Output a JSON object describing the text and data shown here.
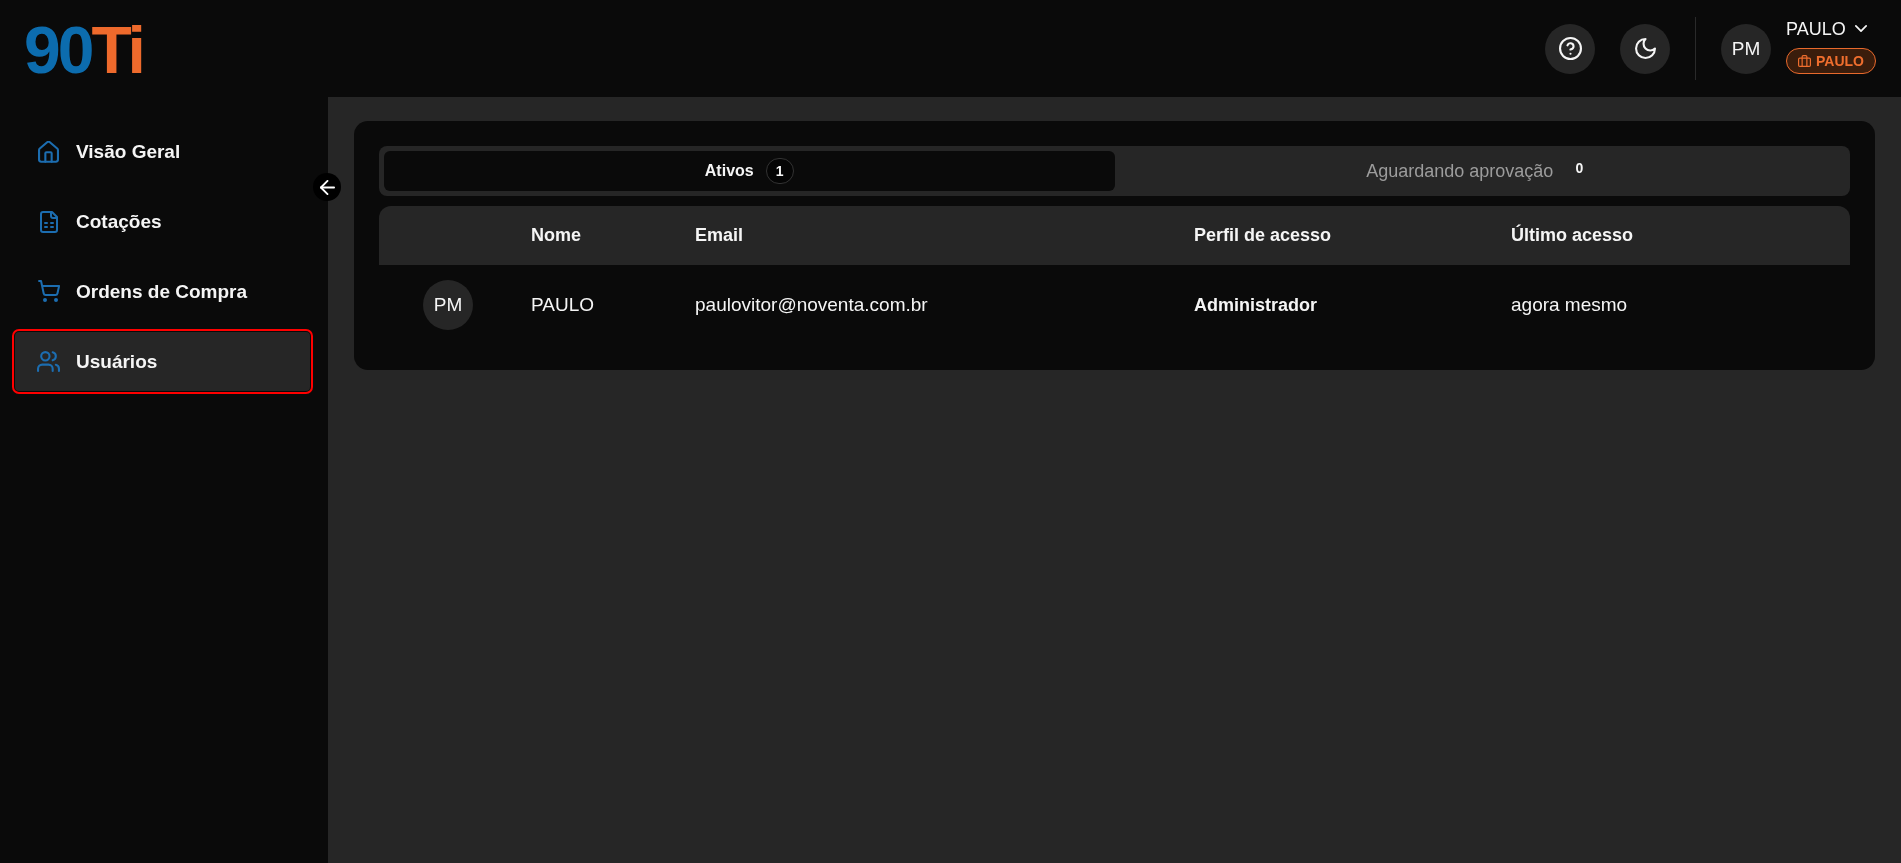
{
  "header": {
    "logo": {
      "primary": "90",
      "accent": "Ti"
    },
    "user": {
      "initials": "PM",
      "name": "PAULO",
      "company": "PAULO"
    }
  },
  "sidebar": {
    "items": [
      {
        "label": "Visão Geral",
        "selected": false,
        "highlighted": false
      },
      {
        "label": "Cotações",
        "selected": false,
        "highlighted": false
      },
      {
        "label": "Ordens de Compra",
        "selected": false,
        "highlighted": false
      },
      {
        "label": "Usuários",
        "selected": true,
        "highlighted": true
      }
    ]
  },
  "tabs": [
    {
      "label": "Ativos",
      "count": "1",
      "selected": true
    },
    {
      "label": "Aguardando aprovação",
      "count": "0",
      "selected": false
    }
  ],
  "table": {
    "columns": [
      "Nome",
      "Email",
      "Perfil de acesso",
      "Último acesso"
    ],
    "rows": [
      {
        "initials": "PM",
        "name": "PAULO",
        "email": "paulovitor@noventa.com.br",
        "role": "Administrador",
        "last_access": "agora mesmo"
      }
    ]
  }
}
